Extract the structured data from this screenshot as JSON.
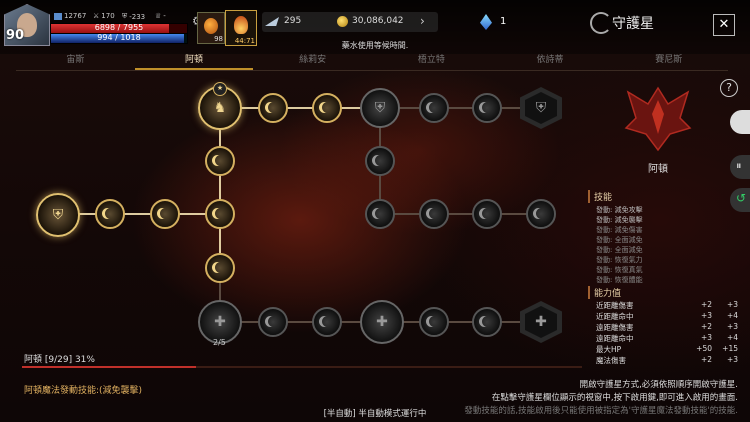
{
  "player": {
    "level": "90",
    "stat1": "12767",
    "stat2": "170",
    "stat3": "-233",
    "stat4": "-",
    "hp": "6898 / 7955",
    "mp": "994 / 1018",
    "hp_ratio": 0.87,
    "mp_ratio": 0.98
  },
  "items": {
    "potion_count": "98",
    "buff_timer": "44:71"
  },
  "currency": {
    "feather": "295",
    "gold": "30,086,042",
    "gem": "1"
  },
  "header": {
    "title": "守護星",
    "notice": "藥水使用等候時間."
  },
  "tabs": [
    "宙斯",
    "阿頓",
    "絲莉安",
    "梧立特",
    "依詩蒂",
    "賽尼斯"
  ],
  "active_tab": 1,
  "tree": {
    "gate_count": "2/5"
  },
  "progress": {
    "label": "阿頓 [9/29] 31%",
    "ratio": 0.31
  },
  "skill_text": "阿頓魔法發動技能:(減免襲擊)",
  "guide": [
    "開啟守護星方式,必須依照順序開啟守護星.",
    "在點擊守護星欄位顯示的視窗中,按下啟用鍵,即可進入啟用的畫面.",
    "發動技能的話,技能啟用後只能使用被指定為'守護星魔法發動技能'的技能."
  ],
  "auto_mode": "[半自動] 半自動模式運行中",
  "panel": {
    "name": "阿頓",
    "skills_title": "技能",
    "skills": [
      "發動: 減免攻擊",
      "發動: 減免襲擊",
      "發動: 減免傷害",
      "發動: 全面減免",
      "發動: 全面減免",
      "發動: 恢復氣力",
      "發動: 恢復真氣",
      "發動: 恢復體能",
      "發動: 恢復能量"
    ],
    "abilities_title": "能力值",
    "abilities": [
      {
        "name": "近距離傷害",
        "a": "+2",
        "b": "+3"
      },
      {
        "name": "近距離命中",
        "a": "+3",
        "b": "+4"
      },
      {
        "name": "遠距離傷害",
        "a": "+2",
        "b": "+3"
      },
      {
        "name": "遠距離命中",
        "a": "+3",
        "b": "+4"
      },
      {
        "name": "最大HP",
        "a": "+50",
        "b": "+15"
      },
      {
        "name": "魔法傷害",
        "a": "+2",
        "b": "+3"
      }
    ]
  }
}
